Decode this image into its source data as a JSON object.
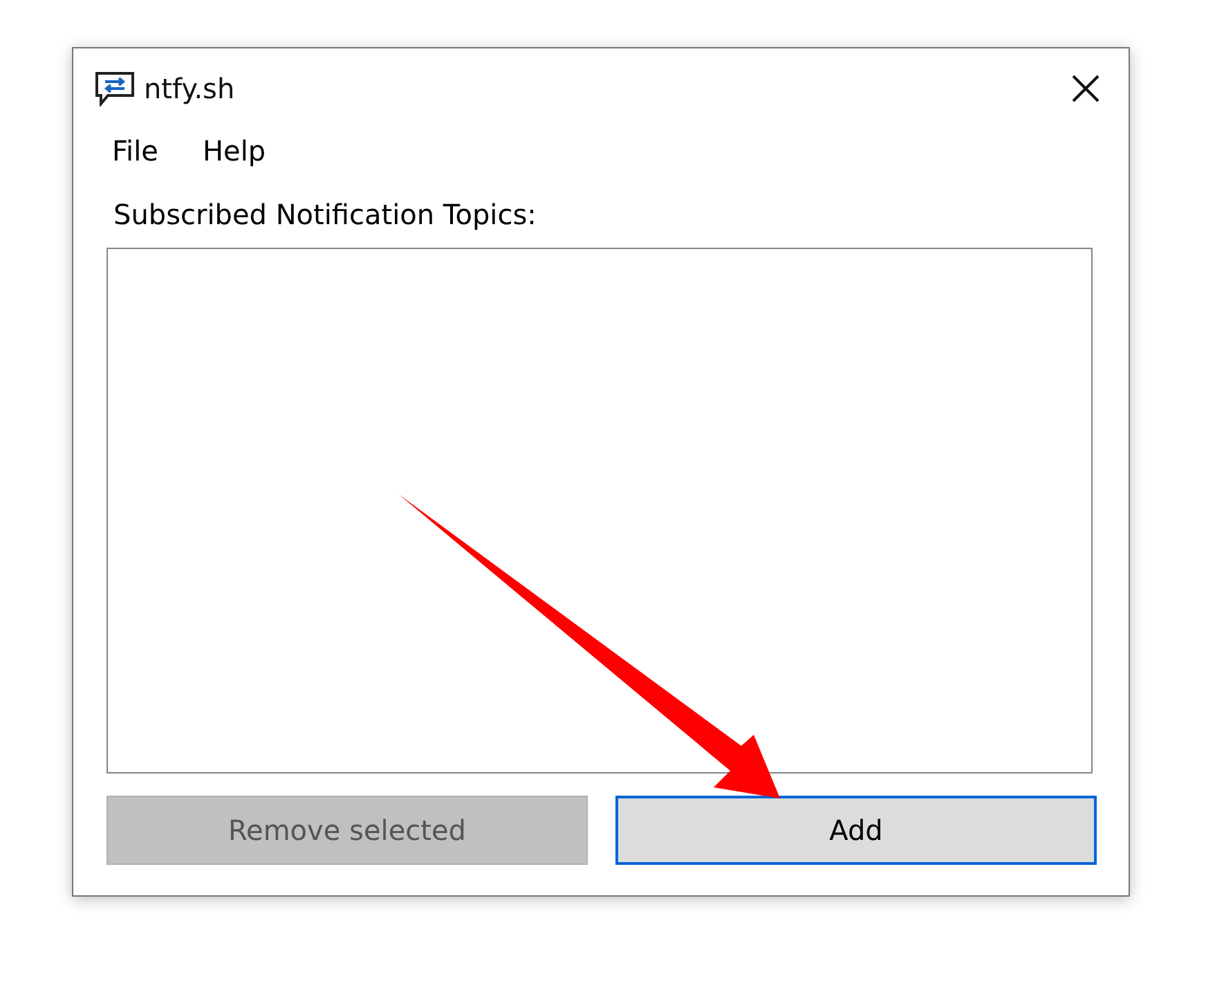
{
  "window": {
    "title": "ntfy.sh"
  },
  "menu": [
    {
      "label": "File"
    },
    {
      "label": "Help"
    }
  ],
  "list_label": "Subscribed Notification Topics:",
  "buttons": [
    {
      "label": "Remove selected",
      "disabled": true,
      "focused": false
    },
    {
      "label": "Add",
      "disabled": false,
      "focused": true
    }
  ]
}
